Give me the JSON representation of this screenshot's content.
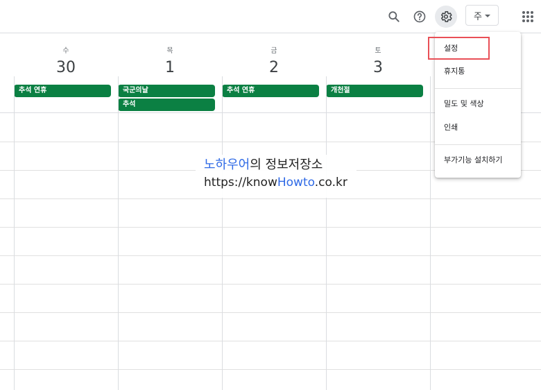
{
  "toolbar": {
    "search_icon": "search-icon",
    "help_icon": "help-icon",
    "settings_icon": "gear-icon",
    "view_label": "주",
    "apps_icon": "apps-grid-icon"
  },
  "days": [
    {
      "dow": "수",
      "date": "30"
    },
    {
      "dow": "목",
      "date": "1"
    },
    {
      "dow": "금",
      "date": "2"
    },
    {
      "dow": "토",
      "date": "3"
    }
  ],
  "events": {
    "wed_1": "추석 연휴",
    "thu_1": "국군의날",
    "thu_2": "추석",
    "fri_1": "추석 연휴",
    "sat_1": "개천절"
  },
  "event_color": "#0b8043",
  "watermark": {
    "blue_text": "노하우어",
    "rest_text": "의 정보저장소",
    "url_prefix": "https://know",
    "url_blue": "Howto",
    "url_suffix": ".co.kr"
  },
  "menu": {
    "settings": "설정",
    "trash": "휴지통",
    "density_color": "밀도 및 색상",
    "print": "인쇄",
    "install_addons": "부가기능 설치하기"
  },
  "highlight_color": "#e94f56"
}
